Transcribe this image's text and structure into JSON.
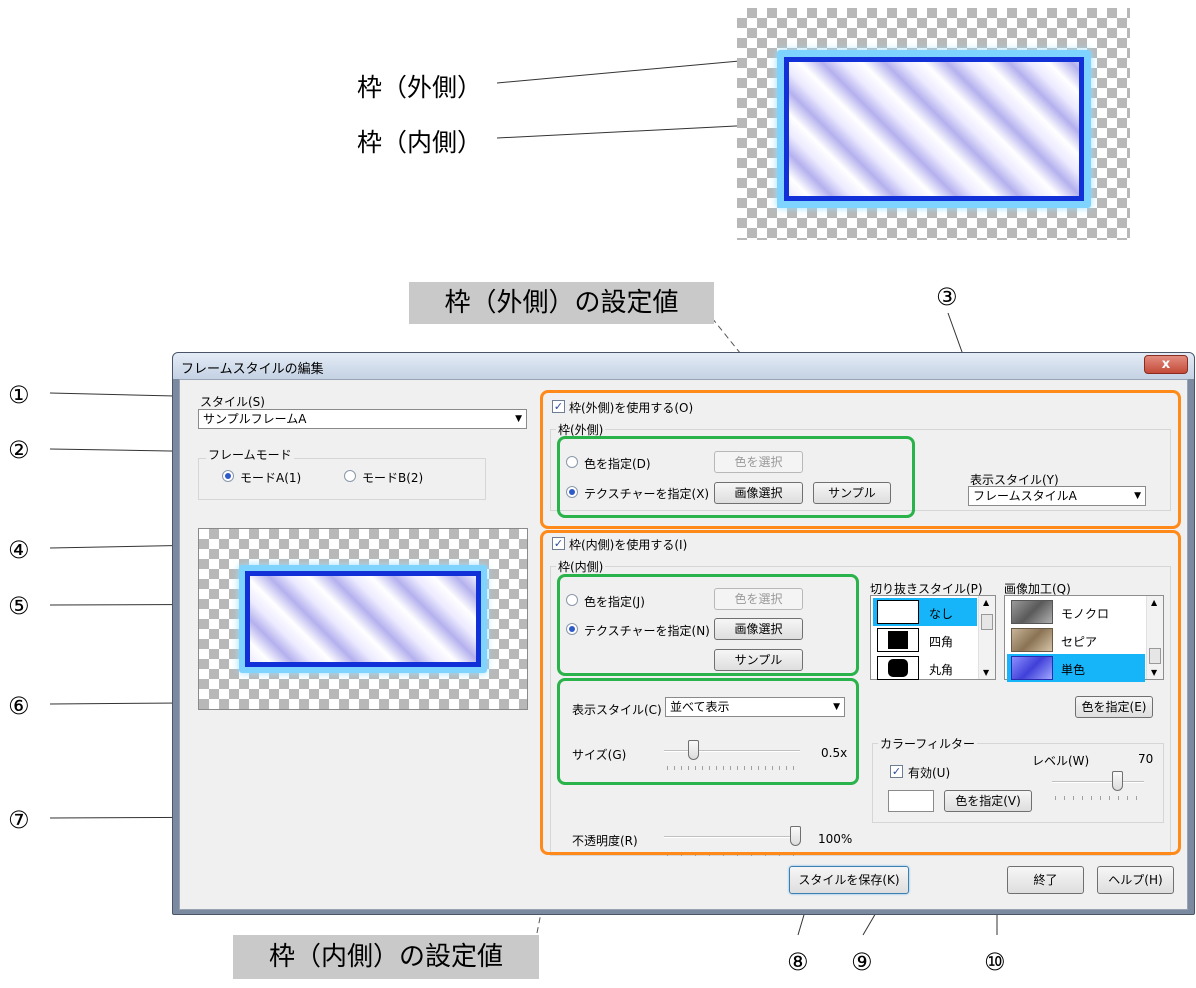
{
  "labels": {
    "outer_frame": "枠（外側）",
    "inner_frame": "枠（内側）",
    "outer_settings": "枠（外側）の設定値",
    "inner_settings": "枠（内側）の設定値"
  },
  "markers": [
    "①",
    "②",
    "③",
    "④",
    "⑤",
    "⑥",
    "⑦",
    "⑧",
    "⑨",
    "⑩"
  ],
  "window": {
    "title": "フレームスタイルの編集",
    "close": "x"
  },
  "left": {
    "style_label": "スタイル(S)",
    "style_value": "サンプルフレームA",
    "frame_mode_label": "フレームモード",
    "mode_a": "モードA(1)",
    "mode_b": "モードB(2)"
  },
  "outer": {
    "use_checkbox": "枠(外側)を使用する(O)",
    "group_label": "枠(外側)",
    "color_radio": "色を指定(D)",
    "color_button": "色を選択",
    "texture_radio": "テクスチャーを指定(X)",
    "image_button": "画像選択",
    "sample_button": "サンプル",
    "display_style_label": "表示スタイル(Y)",
    "display_style_value": "フレームスタイルA"
  },
  "inner": {
    "use_checkbox": "枠(内側)を使用する(I)",
    "group_label": "枠(内側)",
    "color_radio": "色を指定(J)",
    "color_button": "色を選択",
    "texture_radio": "テクスチャーを指定(N)",
    "image_button": "画像選択",
    "sample_button": "サンプル",
    "display_style_label": "表示スタイル(C)",
    "display_style_value": "並べて表示",
    "size_label": "サイズ(G)",
    "size_value": "0.5x",
    "opacity_label": "不透明度(R)",
    "opacity_value": "100%",
    "cutout_label": "切り抜きスタイル(P)",
    "cutout_items": [
      "なし",
      "四角",
      "丸角"
    ],
    "image_proc_label": "画像加工(Q)",
    "image_proc_items": [
      "モノクロ",
      "セピア",
      "単色"
    ],
    "color_specify_button": "色を指定(E)",
    "color_filter_label": "カラーフィルター",
    "filter_enabled": "有効(U)",
    "level_label": "レベル(W)",
    "level_value": "70",
    "filter_color_button": "色を指定(V)"
  },
  "footer": {
    "save_button": "スタイルを保存(K)",
    "exit_button": "終了",
    "help_button": "ヘルプ(H)"
  },
  "colors": {
    "orange": "#ff8a1a",
    "green": "#29b34a",
    "highlight": "#16b4f8"
  }
}
